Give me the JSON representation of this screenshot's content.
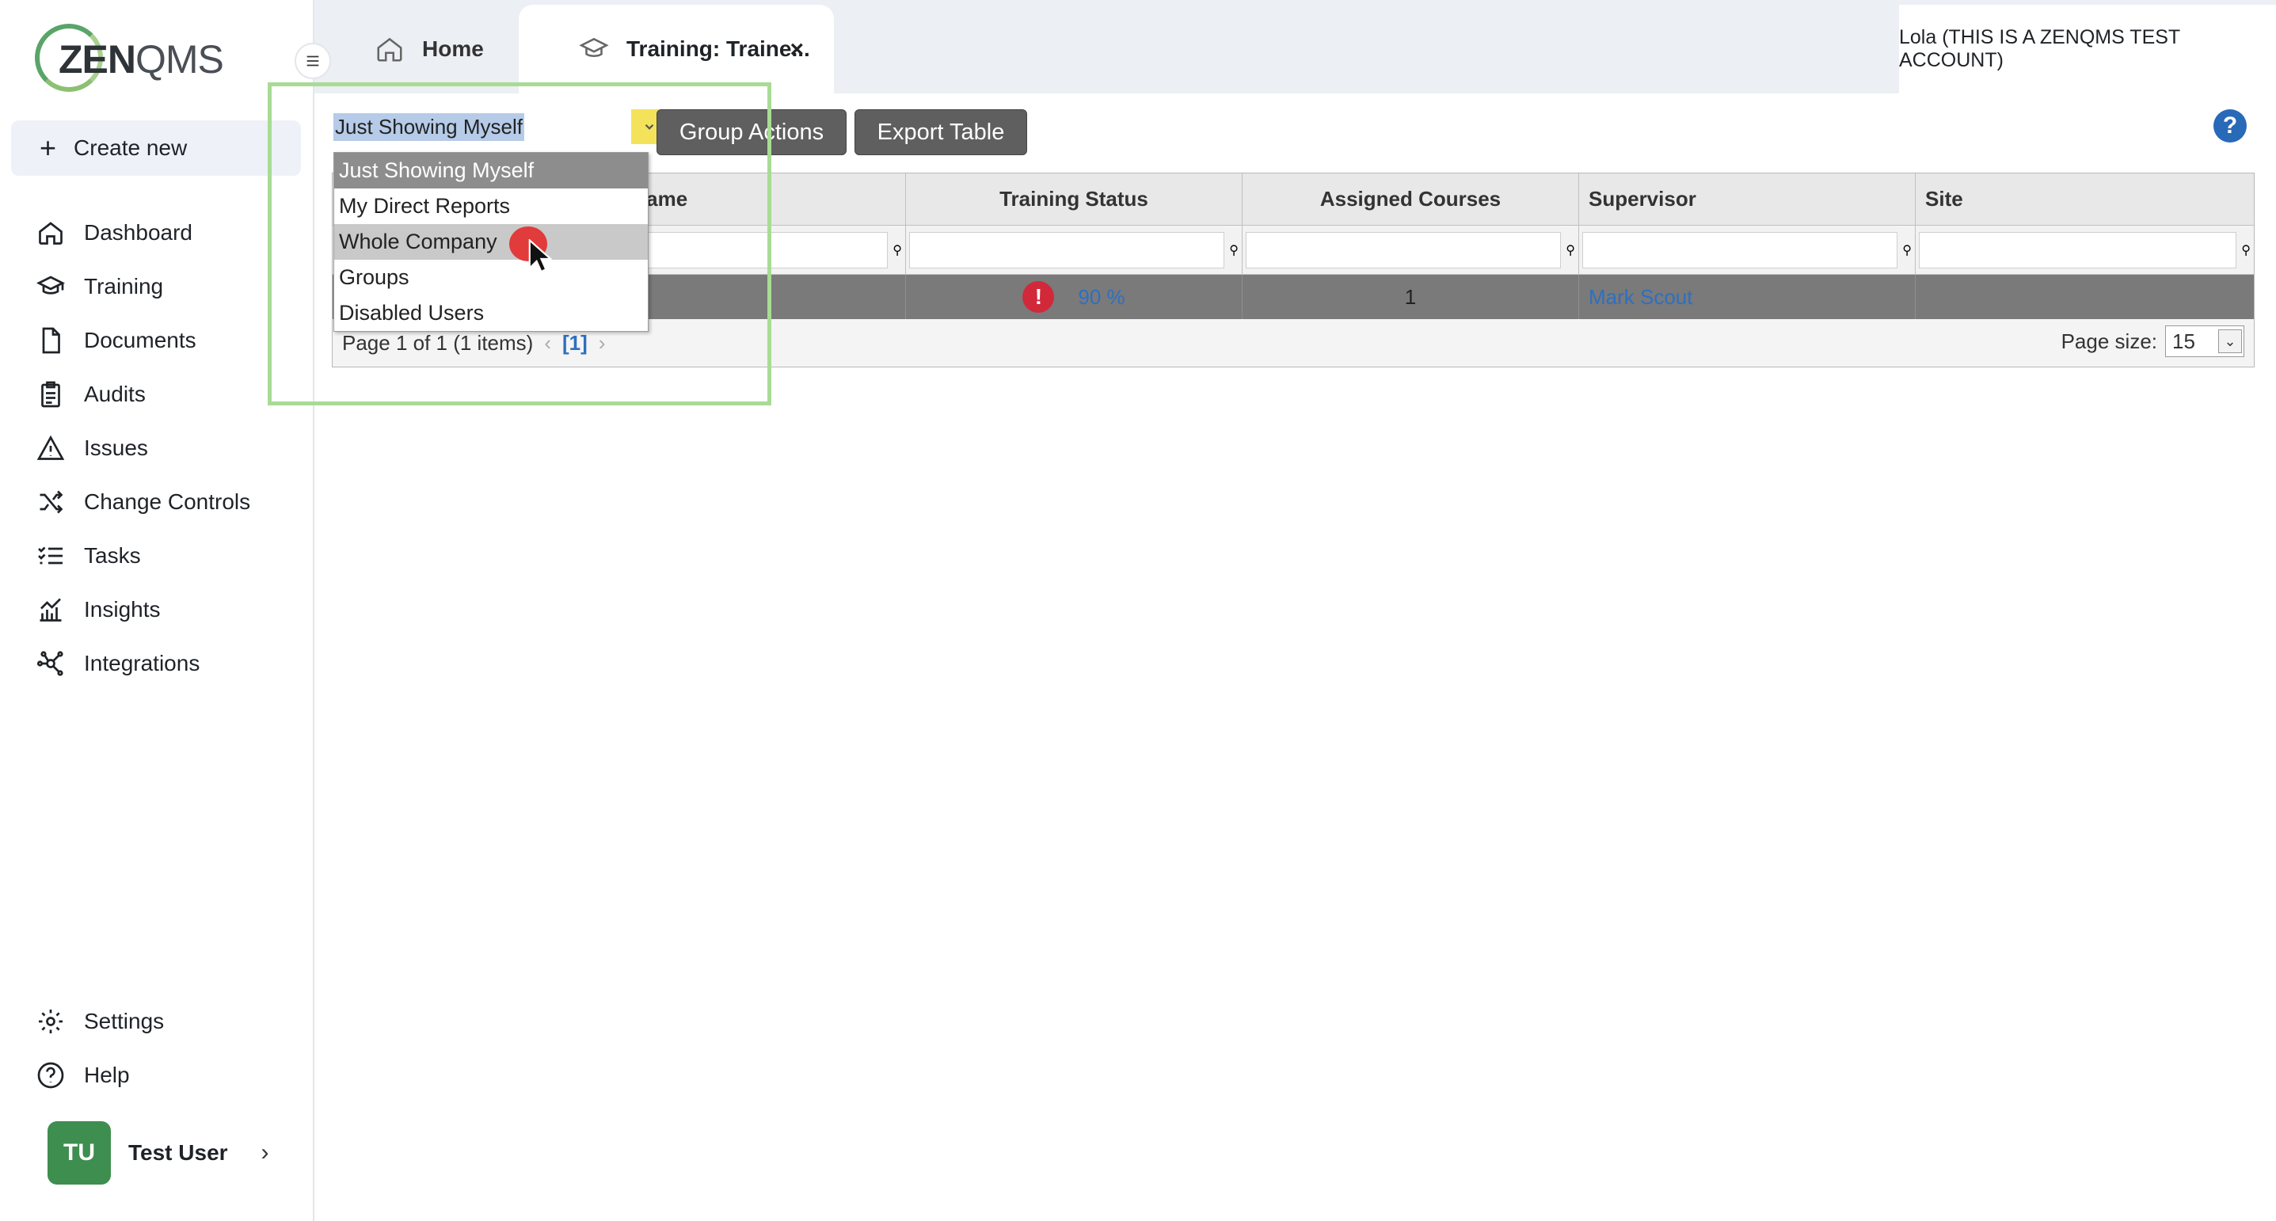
{
  "logo": {
    "zen": "ZEN",
    "qms": "QMS"
  },
  "sidebar": {
    "create_new": "Create new",
    "items": [
      {
        "label": "Dashboard",
        "icon": "home-icon"
      },
      {
        "label": "Training",
        "icon": "graduation-cap-icon"
      },
      {
        "label": "Documents",
        "icon": "document-icon"
      },
      {
        "label": "Audits",
        "icon": "clipboard-icon"
      },
      {
        "label": "Issues",
        "icon": "warning-icon"
      },
      {
        "label": "Change Controls",
        "icon": "shuffle-icon"
      },
      {
        "label": "Tasks",
        "icon": "checklist-icon"
      },
      {
        "label": "Insights",
        "icon": "chart-icon"
      },
      {
        "label": "Integrations",
        "icon": "network-icon"
      }
    ],
    "bottom": [
      {
        "label": "Settings",
        "icon": "gear-icon"
      },
      {
        "label": "Help",
        "icon": "help-circle-icon"
      }
    ],
    "user": {
      "initials": "TU",
      "name": "Test User"
    }
  },
  "tabs": {
    "home": "Home",
    "training": "Training: Traine...",
    "close": "×"
  },
  "account": "Lola (THIS IS A ZENQMS TEST ACCOUNT)",
  "toolbar": {
    "view_value": "Just Showing Myself",
    "group_actions": "Group Actions",
    "export_table": "Export Table",
    "help": "?"
  },
  "dropdown": {
    "options": [
      "Just Showing Myself",
      "My Direct Reports",
      "Whole Company",
      "Groups",
      "Disabled Users"
    ]
  },
  "grid": {
    "headers": [
      "(Group) Name",
      "Training Status",
      "Assigned Courses",
      "Supervisor",
      "Site"
    ],
    "row": {
      "status": "90 %",
      "assigned": "1",
      "supervisor": "Mark Scout",
      "site": ""
    },
    "pager": "Page 1 of 1 (1 items)",
    "pager_current": "[1]",
    "page_size_label": "Page size:",
    "page_size": "15"
  },
  "colors": {
    "accent": "#5aa469",
    "highlight": "#a8dc95",
    "click": "#e23b3b",
    "help": "#2869b8"
  }
}
